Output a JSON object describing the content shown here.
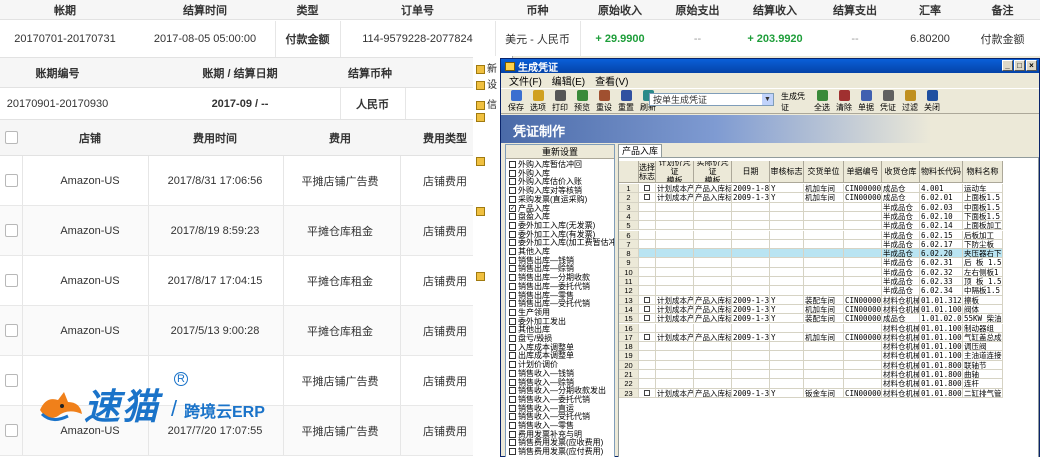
{
  "settlement_table": {
    "headers": [
      "帐期",
      "结算时间",
      "类型",
      "订单号",
      "币种",
      "原始收入",
      "原始支出",
      "结算收入",
      "结算支出",
      "汇率",
      "备注"
    ],
    "row": {
      "period": "20170701-20170731",
      "time": "2017-08-05 05:00:00",
      "type": "付款金额",
      "order": "114-9579228-2077824",
      "currency": "美元 - 人民币",
      "orig_income": "+ 29.9900",
      "orig_expense": "--",
      "settle_income": "+ 203.9920",
      "settle_expense": "--",
      "rate": "6.80200",
      "note": "付款金额"
    }
  },
  "account_table": {
    "headers": [
      "账期编号",
      "账期 / 结算日期",
      "结算币种"
    ],
    "row": {
      "id": "20170901-20170930",
      "date": "2017-09 / --",
      "currency": "人民币"
    }
  },
  "fee_table": {
    "headers": [
      "店铺",
      "费用时间",
      "费用",
      "费用类型"
    ],
    "rows": [
      {
        "shop": "Amazon-US",
        "time": "2017/8/31 17:06:56",
        "fee": "平摊店铺广告费",
        "type": "店铺费用"
      },
      {
        "shop": "Amazon-US",
        "time": "2017/8/19 8:59:23",
        "fee": "平摊仓库租金",
        "type": "店铺费用"
      },
      {
        "shop": "Amazon-US",
        "time": "2017/8/17 17:04:15",
        "fee": "平摊仓库租金",
        "type": "店铺费用"
      },
      {
        "shop": "Amazon-US",
        "time": "2017/5/13 9:00:28",
        "fee": "平摊仓库租金",
        "type": "店铺费用"
      },
      {
        "shop": "",
        "time": "",
        "fee": "平摊店铺广告费",
        "type": "店铺费用"
      },
      {
        "shop": "Amazon-US",
        "time": "2017/7/20 17:07:55",
        "fee": "平摊店铺广告费",
        "type": "店铺费用"
      }
    ]
  },
  "logo": {
    "name": "速猫",
    "sub": "跨境云ERP",
    "reg": "R"
  },
  "bg_window": {
    "items": [
      "新",
      "设",
      "信",
      "",
      "",
      "",
      "",
      ""
    ]
  },
  "dialog": {
    "title": "生成凭证",
    "menu": [
      "文件(F)",
      "编辑(E)",
      "查看(V)"
    ],
    "toolbar": [
      {
        "label": "保存",
        "color": "#3a6fd0"
      },
      {
        "label": "选项",
        "color": "#d0a020"
      },
      {
        "label": "打印",
        "color": "#555555"
      },
      {
        "label": "预览",
        "color": "#3a8a3a"
      },
      {
        "label": "重设",
        "color": "#a05030"
      },
      {
        "label": "重置",
        "color": "#3050a0"
      },
      {
        "label": "刷新",
        "color": "#2a8a8a"
      }
    ],
    "select_value": "按单生成凭证",
    "toolbar_right": [
      {
        "label": "生成凭证",
        "color": "#c04040"
      },
      {
        "label": "全选",
        "color": "#3a8a3a"
      },
      {
        "label": "清除",
        "color": "#a03030"
      },
      {
        "label": "单据",
        "color": "#4060b0"
      },
      {
        "label": "凭证",
        "color": "#606060"
      },
      {
        "label": "过滤",
        "color": "#c09020"
      },
      {
        "label": "关闭",
        "color": "#2050a0"
      }
    ],
    "banner_title": "凭证制作",
    "reset_button": "重新设置",
    "left_items": [
      "外购入库暂估冲回",
      "外购入库",
      "外购入库估价入账",
      "外购入库对等核销",
      "采购发票(直运采购)",
      "产品入库",
      "盘盈入库",
      "委外加工入库(无发票)",
      "委外加工入库(有发票)",
      "委外加工入库(加工费暂估冲",
      "其他入库",
      "销售出库—钱销",
      "销售出库—赊销",
      "销售出库—分期收款",
      "销售出库—委托代销",
      "销售出库—零售",
      "销售出库—受托代销",
      "生产领用",
      "委外加工发出",
      "其他出库",
      "盘亏/毁损",
      "入库成本调整单",
      "出库成本调整单",
      "计划价调价",
      "销售收入—钱销",
      "销售收入—赊销",
      "销售收入—分期收款发出",
      "销售收入—委托代销",
      "销售收入—直运",
      "销售收入—受托代销",
      "销售收入—零售",
      "费用发票补充与明",
      "销售费用发票(应收费用)",
      "销售费用发票(应付费用)"
    ],
    "left_checked_index": 5,
    "tab": "产品入库",
    "grid_headers": [
      "",
      "选择\n标志",
      "计划价凭证\n模板",
      "实际价凭证\n模板",
      "日期",
      "审核标志",
      "交货单位",
      "单据编号",
      "收货仓库",
      "物料长代码",
      "物料名称"
    ],
    "grid_rows": [
      [
        "1",
        "",
        "计划成本产品",
        "产品入库标准",
        "2009-1-8",
        "Y",
        "机加车间",
        "CIN000001",
        "成品仓",
        "4.001",
        "运动车"
      ],
      [
        "2",
        "",
        "计划成本产品",
        "产品入库标准",
        "2009-1-30",
        "Y",
        "机加车间",
        "CIN000002",
        "成品仓",
        "6.02.01",
        "上面板1.5"
      ],
      [
        "3",
        "",
        "",
        "",
        "",
        "",
        "",
        "",
        "半成品仓",
        "6.02.03",
        "中面板1.5"
      ],
      [
        "4",
        "",
        "",
        "",
        "",
        "",
        "",
        "",
        "半成品仓",
        "6.02.10",
        "下面板1.5"
      ],
      [
        "5",
        "",
        "",
        "",
        "",
        "",
        "",
        "",
        "半成品仓",
        "6.02.14",
        "上面板加工"
      ],
      [
        "6",
        "",
        "",
        "",
        "",
        "",
        "",
        "",
        "半成品仓",
        "6.02.15",
        "后板加工"
      ],
      [
        "7",
        "",
        "",
        "",
        "",
        "",
        "",
        "",
        "半成品仓",
        "6.02.17",
        "下防尘板"
      ],
      [
        "8",
        "",
        "",
        "",
        "",
        "",
        "",
        "",
        "半成品仓",
        "6.02.20",
        "夹压器右下"
      ],
      [
        "9",
        "",
        "",
        "",
        "",
        "",
        "",
        "",
        "半成品仓",
        "6.02.31",
        "后 板 1.5"
      ],
      [
        "10",
        "",
        "",
        "",
        "",
        "",
        "",
        "",
        "半成品仓",
        "6.02.32",
        "左右侧板1"
      ],
      [
        "11",
        "",
        "",
        "",
        "",
        "",
        "",
        "",
        "半成品仓",
        "6.02.33",
        "顶 板 1.5"
      ],
      [
        "12",
        "",
        "",
        "",
        "",
        "",
        "",
        "",
        "半成品仓",
        "6.02.34",
        "中隔板1.5"
      ],
      [
        "13",
        "",
        "计划成本产品",
        "产品入库标准",
        "2009-1-30",
        "Y",
        "装配车间",
        "CIN000003",
        "材料仓机械",
        "01.01.312-00",
        "擦板"
      ],
      [
        "14",
        "",
        "计划成本产品",
        "产品入库标准",
        "2009-1-30",
        "Y",
        "机加车间",
        "CIN000004",
        "材料仓机械",
        "01.01.100-00",
        "阀体"
      ],
      [
        "15",
        "",
        "计划成本产品",
        "产品入库标准",
        "2009-1-30",
        "Y",
        "装配车间",
        "CIN000005",
        "成品仓",
        "1.01.02.001",
        "55KW 柴油机"
      ],
      [
        "16",
        "",
        "",
        "",
        "",
        "",
        "",
        "",
        "材料仓机械",
        "01.01.100-00",
        "制动器组"
      ],
      [
        "17",
        "",
        "计划成本产品",
        "产品入库标准",
        "2009-1-30",
        "Y",
        "机加车间",
        "CIN000006",
        "材料仓机械",
        "01.01.100-00",
        "气缸盖总成"
      ],
      [
        "18",
        "",
        "",
        "",
        "",
        "",
        "",
        "",
        "材料仓机械",
        "01.01.100-00",
        "调压阀"
      ],
      [
        "19",
        "",
        "",
        "",
        "",
        "",
        "",
        "",
        "材料仓机械",
        "01.01.100-00",
        "主油道连接"
      ],
      [
        "20",
        "",
        "",
        "",
        "",
        "",
        "",
        "",
        "材料仓机械",
        "01.01.800-10",
        "联轴节"
      ],
      [
        "21",
        "",
        "",
        "",
        "",
        "",
        "",
        "",
        "材料仓机械",
        "01.01.800-10",
        "曲轴"
      ],
      [
        "22",
        "",
        "",
        "",
        "",
        "",
        "",
        "",
        "材料仓机械",
        "01.01.800-10",
        "连杆"
      ],
      [
        "23",
        "",
        "计划成本产品",
        "产品入库标准",
        "2009-1-30",
        "Y",
        "钣金车间",
        "CIN000007",
        "材料仓机械",
        "01.01.800-10",
        "二缸排气管"
      ]
    ],
    "selected_row_index": 7
  }
}
